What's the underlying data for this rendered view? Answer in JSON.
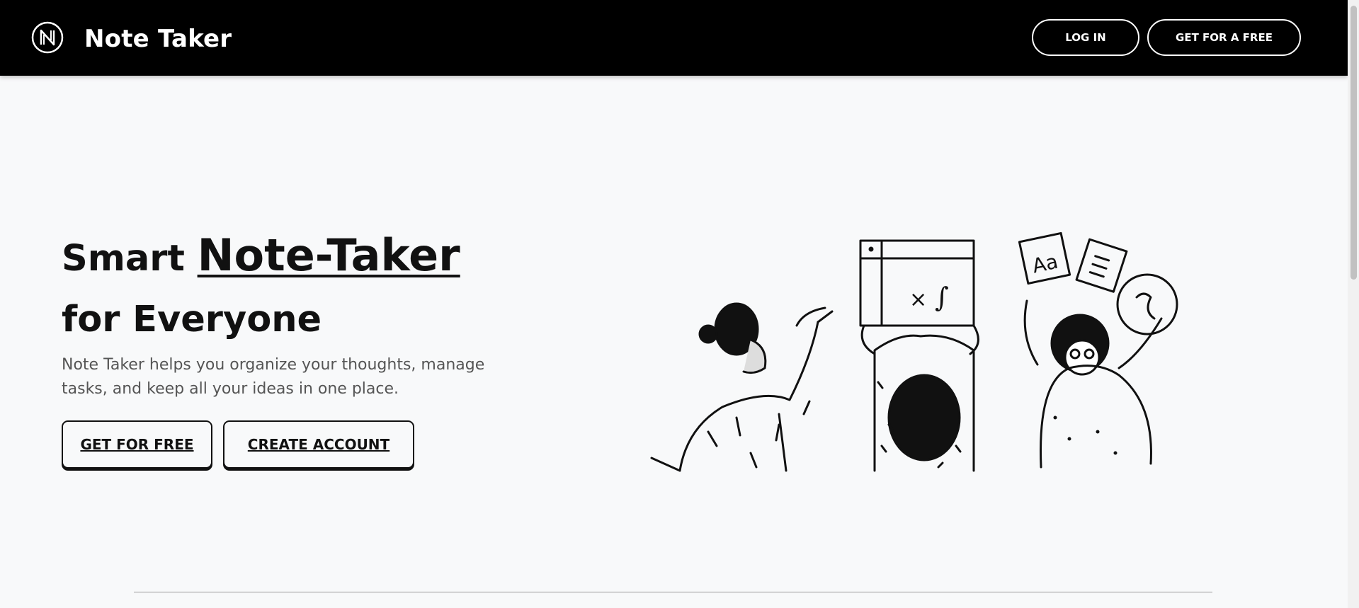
{
  "header": {
    "brand_name": "Note Taker",
    "login_label": "LOG IN",
    "get_free_label": "GET FOR A FREE"
  },
  "hero": {
    "title_prefix": "Smart",
    "title_highlight": "Note-Taker",
    "title_line2": "for Everyone",
    "description": "Note Taker helps you organize your thoughts, manage tasks, and keep all your ideas in one place.",
    "cta_primary": "GET FOR FREE",
    "cta_secondary": "CREATE ACCOUNT"
  },
  "illustration": {
    "board_symbols": [
      "×",
      "∫"
    ],
    "card_text": "Aa"
  },
  "colors": {
    "header_bg": "#000000",
    "page_bg": "#f8f9fa",
    "text": "#111111",
    "muted_text": "#555555"
  },
  "icons": [
    "logo-icon"
  ]
}
